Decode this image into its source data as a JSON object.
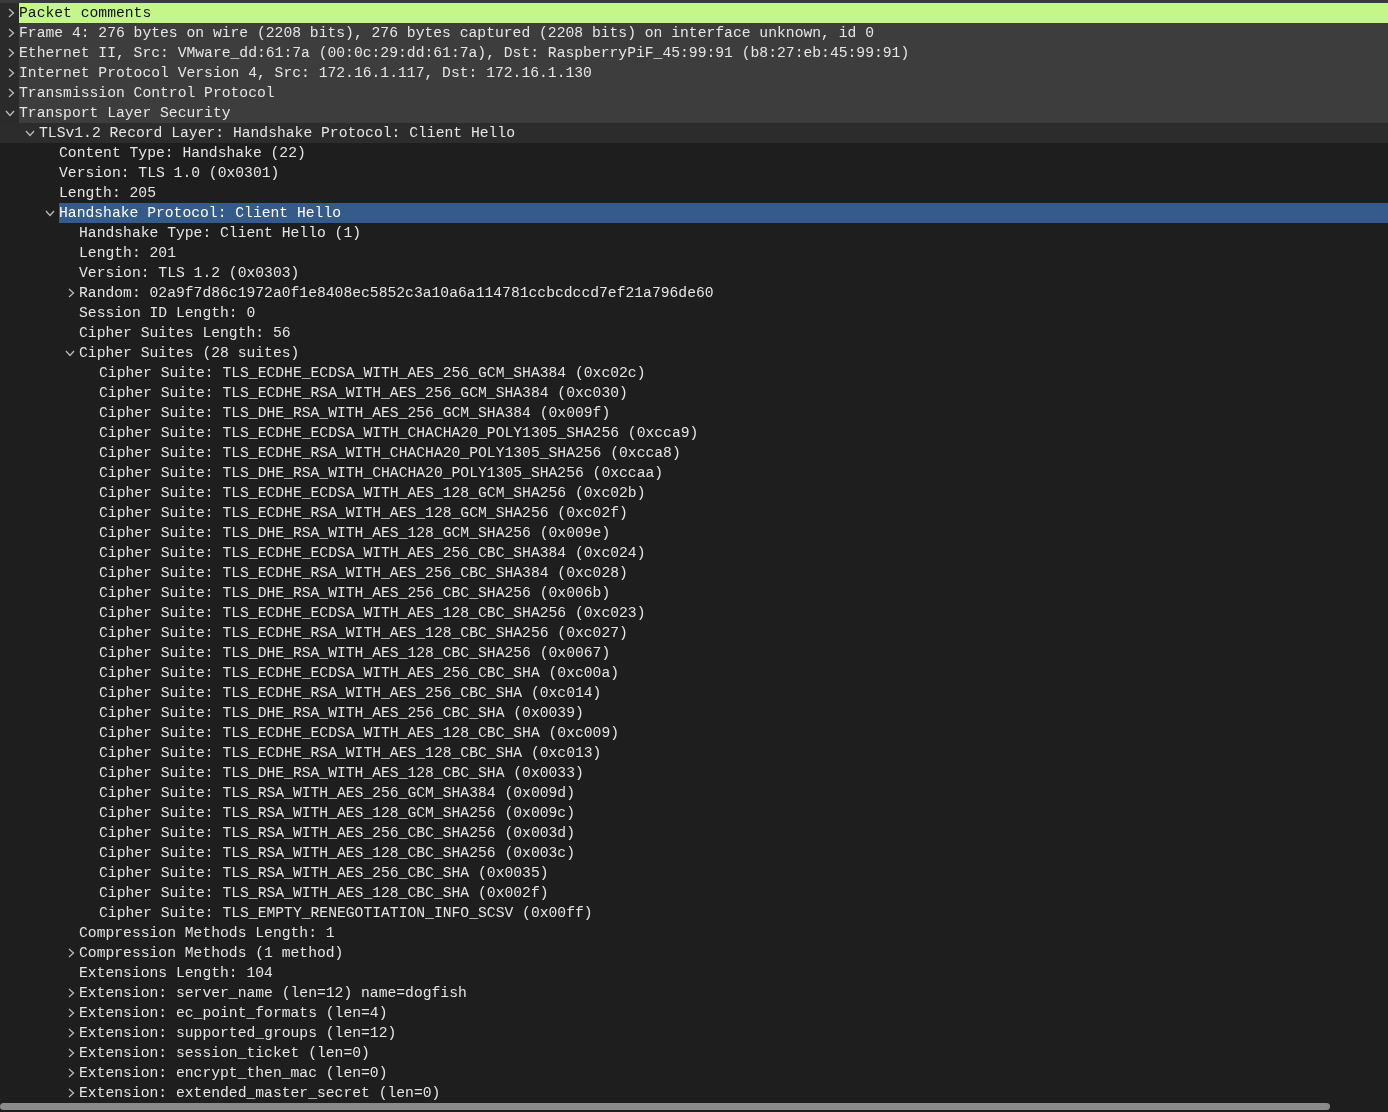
{
  "tree": [
    {
      "label": "Packet comments",
      "expanded": false,
      "selected": false,
      "color": "#c4f68a"
    },
    {
      "label": "Frame 4: 276 bytes on wire (2208 bits), 276 bytes captured (2208 bits) on interface unknown, id 0",
      "expanded": false,
      "selected": false
    },
    {
      "label": "Ethernet II, Src: VMware_dd:61:7a (00:0c:29:dd:61:7a), Dst: RaspberryPiF_45:99:91 (b8:27:eb:45:99:91)",
      "expanded": false,
      "selected": false
    },
    {
      "label": "Internet Protocol Version 4, Src: 172.16.1.117, Dst: 172.16.1.130",
      "expanded": false,
      "selected": false
    },
    {
      "label": "Transmission Control Protocol",
      "expanded": false,
      "selected": false
    },
    {
      "label": "Transport Layer Security",
      "expanded": true,
      "selected": false,
      "children": [
        {
          "label": "TLSv1.2 Record Layer: Handshake Protocol: Client Hello",
          "expanded": true,
          "selected": false,
          "children": [
            {
              "label": "Content Type: Handshake (22)",
              "selected": false
            },
            {
              "label": "Version: TLS 1.0 (0x0301)",
              "selected": false
            },
            {
              "label": "Length: 205",
              "selected": false
            },
            {
              "label": "Handshake Protocol: Client Hello",
              "expanded": true,
              "selected": true,
              "children": [
                {
                  "label": "Handshake Type: Client Hello (1)",
                  "selected": false
                },
                {
                  "label": "Length: 201",
                  "selected": false
                },
                {
                  "label": "Version: TLS 1.2 (0x0303)",
                  "selected": false
                },
                {
                  "label": "Random: 02a9f7d86c1972a0f1e8408ec5852c3a10a6a114781ccbcdccd7ef21a796de60",
                  "expanded": false,
                  "selected": false
                },
                {
                  "label": "Session ID Length: 0",
                  "selected": false
                },
                {
                  "label": "Cipher Suites Length: 56",
                  "selected": false
                },
                {
                  "label": "Cipher Suites (28 suites)",
                  "expanded": true,
                  "selected": false,
                  "children": [
                    {
                      "label": "Cipher Suite: TLS_ECDHE_ECDSA_WITH_AES_256_GCM_SHA384 (0xc02c)",
                      "selected": false
                    },
                    {
                      "label": "Cipher Suite: TLS_ECDHE_RSA_WITH_AES_256_GCM_SHA384 (0xc030)",
                      "selected": false
                    },
                    {
                      "label": "Cipher Suite: TLS_DHE_RSA_WITH_AES_256_GCM_SHA384 (0x009f)",
                      "selected": false
                    },
                    {
                      "label": "Cipher Suite: TLS_ECDHE_ECDSA_WITH_CHACHA20_POLY1305_SHA256 (0xcca9)",
                      "selected": false
                    },
                    {
                      "label": "Cipher Suite: TLS_ECDHE_RSA_WITH_CHACHA20_POLY1305_SHA256 (0xcca8)",
                      "selected": false
                    },
                    {
                      "label": "Cipher Suite: TLS_DHE_RSA_WITH_CHACHA20_POLY1305_SHA256 (0xccaa)",
                      "selected": false
                    },
                    {
                      "label": "Cipher Suite: TLS_ECDHE_ECDSA_WITH_AES_128_GCM_SHA256 (0xc02b)",
                      "selected": false
                    },
                    {
                      "label": "Cipher Suite: TLS_ECDHE_RSA_WITH_AES_128_GCM_SHA256 (0xc02f)",
                      "selected": false
                    },
                    {
                      "label": "Cipher Suite: TLS_DHE_RSA_WITH_AES_128_GCM_SHA256 (0x009e)",
                      "selected": false
                    },
                    {
                      "label": "Cipher Suite: TLS_ECDHE_ECDSA_WITH_AES_256_CBC_SHA384 (0xc024)",
                      "selected": false
                    },
                    {
                      "label": "Cipher Suite: TLS_ECDHE_RSA_WITH_AES_256_CBC_SHA384 (0xc028)",
                      "selected": false
                    },
                    {
                      "label": "Cipher Suite: TLS_DHE_RSA_WITH_AES_256_CBC_SHA256 (0x006b)",
                      "selected": false
                    },
                    {
                      "label": "Cipher Suite: TLS_ECDHE_ECDSA_WITH_AES_128_CBC_SHA256 (0xc023)",
                      "selected": false
                    },
                    {
                      "label": "Cipher Suite: TLS_ECDHE_RSA_WITH_AES_128_CBC_SHA256 (0xc027)",
                      "selected": false
                    },
                    {
                      "label": "Cipher Suite: TLS_DHE_RSA_WITH_AES_128_CBC_SHA256 (0x0067)",
                      "selected": false
                    },
                    {
                      "label": "Cipher Suite: TLS_ECDHE_ECDSA_WITH_AES_256_CBC_SHA (0xc00a)",
                      "selected": false
                    },
                    {
                      "label": "Cipher Suite: TLS_ECDHE_RSA_WITH_AES_256_CBC_SHA (0xc014)",
                      "selected": false
                    },
                    {
                      "label": "Cipher Suite: TLS_DHE_RSA_WITH_AES_256_CBC_SHA (0x0039)",
                      "selected": false
                    },
                    {
                      "label": "Cipher Suite: TLS_ECDHE_ECDSA_WITH_AES_128_CBC_SHA (0xc009)",
                      "selected": false
                    },
                    {
                      "label": "Cipher Suite: TLS_ECDHE_RSA_WITH_AES_128_CBC_SHA (0xc013)",
                      "selected": false
                    },
                    {
                      "label": "Cipher Suite: TLS_DHE_RSA_WITH_AES_128_CBC_SHA (0x0033)",
                      "selected": false
                    },
                    {
                      "label": "Cipher Suite: TLS_RSA_WITH_AES_256_GCM_SHA384 (0x009d)",
                      "selected": false
                    },
                    {
                      "label": "Cipher Suite: TLS_RSA_WITH_AES_128_GCM_SHA256 (0x009c)",
                      "selected": false
                    },
                    {
                      "label": "Cipher Suite: TLS_RSA_WITH_AES_256_CBC_SHA256 (0x003d)",
                      "selected": false
                    },
                    {
                      "label": "Cipher Suite: TLS_RSA_WITH_AES_128_CBC_SHA256 (0x003c)",
                      "selected": false
                    },
                    {
                      "label": "Cipher Suite: TLS_RSA_WITH_AES_256_CBC_SHA (0x0035)",
                      "selected": false
                    },
                    {
                      "label": "Cipher Suite: TLS_RSA_WITH_AES_128_CBC_SHA (0x002f)",
                      "selected": false
                    },
                    {
                      "label": "Cipher Suite: TLS_EMPTY_RENEGOTIATION_INFO_SCSV (0x00ff)",
                      "selected": false
                    }
                  ]
                },
                {
                  "label": "Compression Methods Length: 1",
                  "selected": false
                },
                {
                  "label": "Compression Methods (1 method)",
                  "expanded": false,
                  "selected": false
                },
                {
                  "label": "Extensions Length: 104",
                  "selected": false
                },
                {
                  "label": "Extension: server_name (len=12) name=dogfish",
                  "expanded": false,
                  "selected": false
                },
                {
                  "label": "Extension: ec_point_formats (len=4)",
                  "expanded": false,
                  "selected": false
                },
                {
                  "label": "Extension: supported_groups (len=12)",
                  "expanded": false,
                  "selected": false
                },
                {
                  "label": "Extension: session_ticket (len=0)",
                  "expanded": false,
                  "selected": false
                },
                {
                  "label": "Extension: encrypt_then_mac (len=0)",
                  "expanded": false,
                  "selected": false
                },
                {
                  "label": "Extension: extended_master_secret (len=0)",
                  "expanded": false,
                  "selected": false
                }
              ]
            }
          ]
        }
      ]
    }
  ]
}
